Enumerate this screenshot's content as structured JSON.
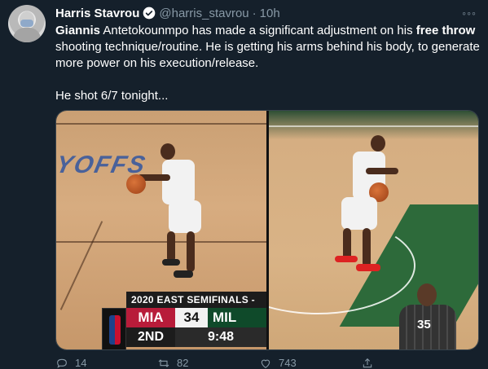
{
  "author": {
    "name": "Harris Stavrou",
    "handle": "@harris_stavrou",
    "separator": "·",
    "time": "10h",
    "verified_icon": "verified-badge-icon",
    "avatar_icon": "avatar"
  },
  "more_label": "◦◦◦",
  "tweet": {
    "line1_bold_a": "Giannis",
    "line1_rest": " Antetokounmpo has made a significant adjustment on his ",
    "line1_bold_b": "free throw",
    "line1_tail": " shooting technique/routine. He is getting his arms behind his body, to generate more power on his execution/release.",
    "line2": "He shot 6/7 tonight..."
  },
  "media": {
    "court_text": "YOFFS",
    "referee_number": "35",
    "scorebug": {
      "title": "2020 EAST SEMIFINALS -",
      "team_a": "MIA",
      "score": "34",
      "team_b": "MIL",
      "quarter": "2ND",
      "clock": "9:48"
    }
  },
  "actions": {
    "reply_count": "14",
    "retweet_count": "82",
    "like_count": "743",
    "share_label": ""
  },
  "colors": {
    "background": "#15202b",
    "secondary_text": "#8899a6",
    "verified": "#1da1f2"
  }
}
